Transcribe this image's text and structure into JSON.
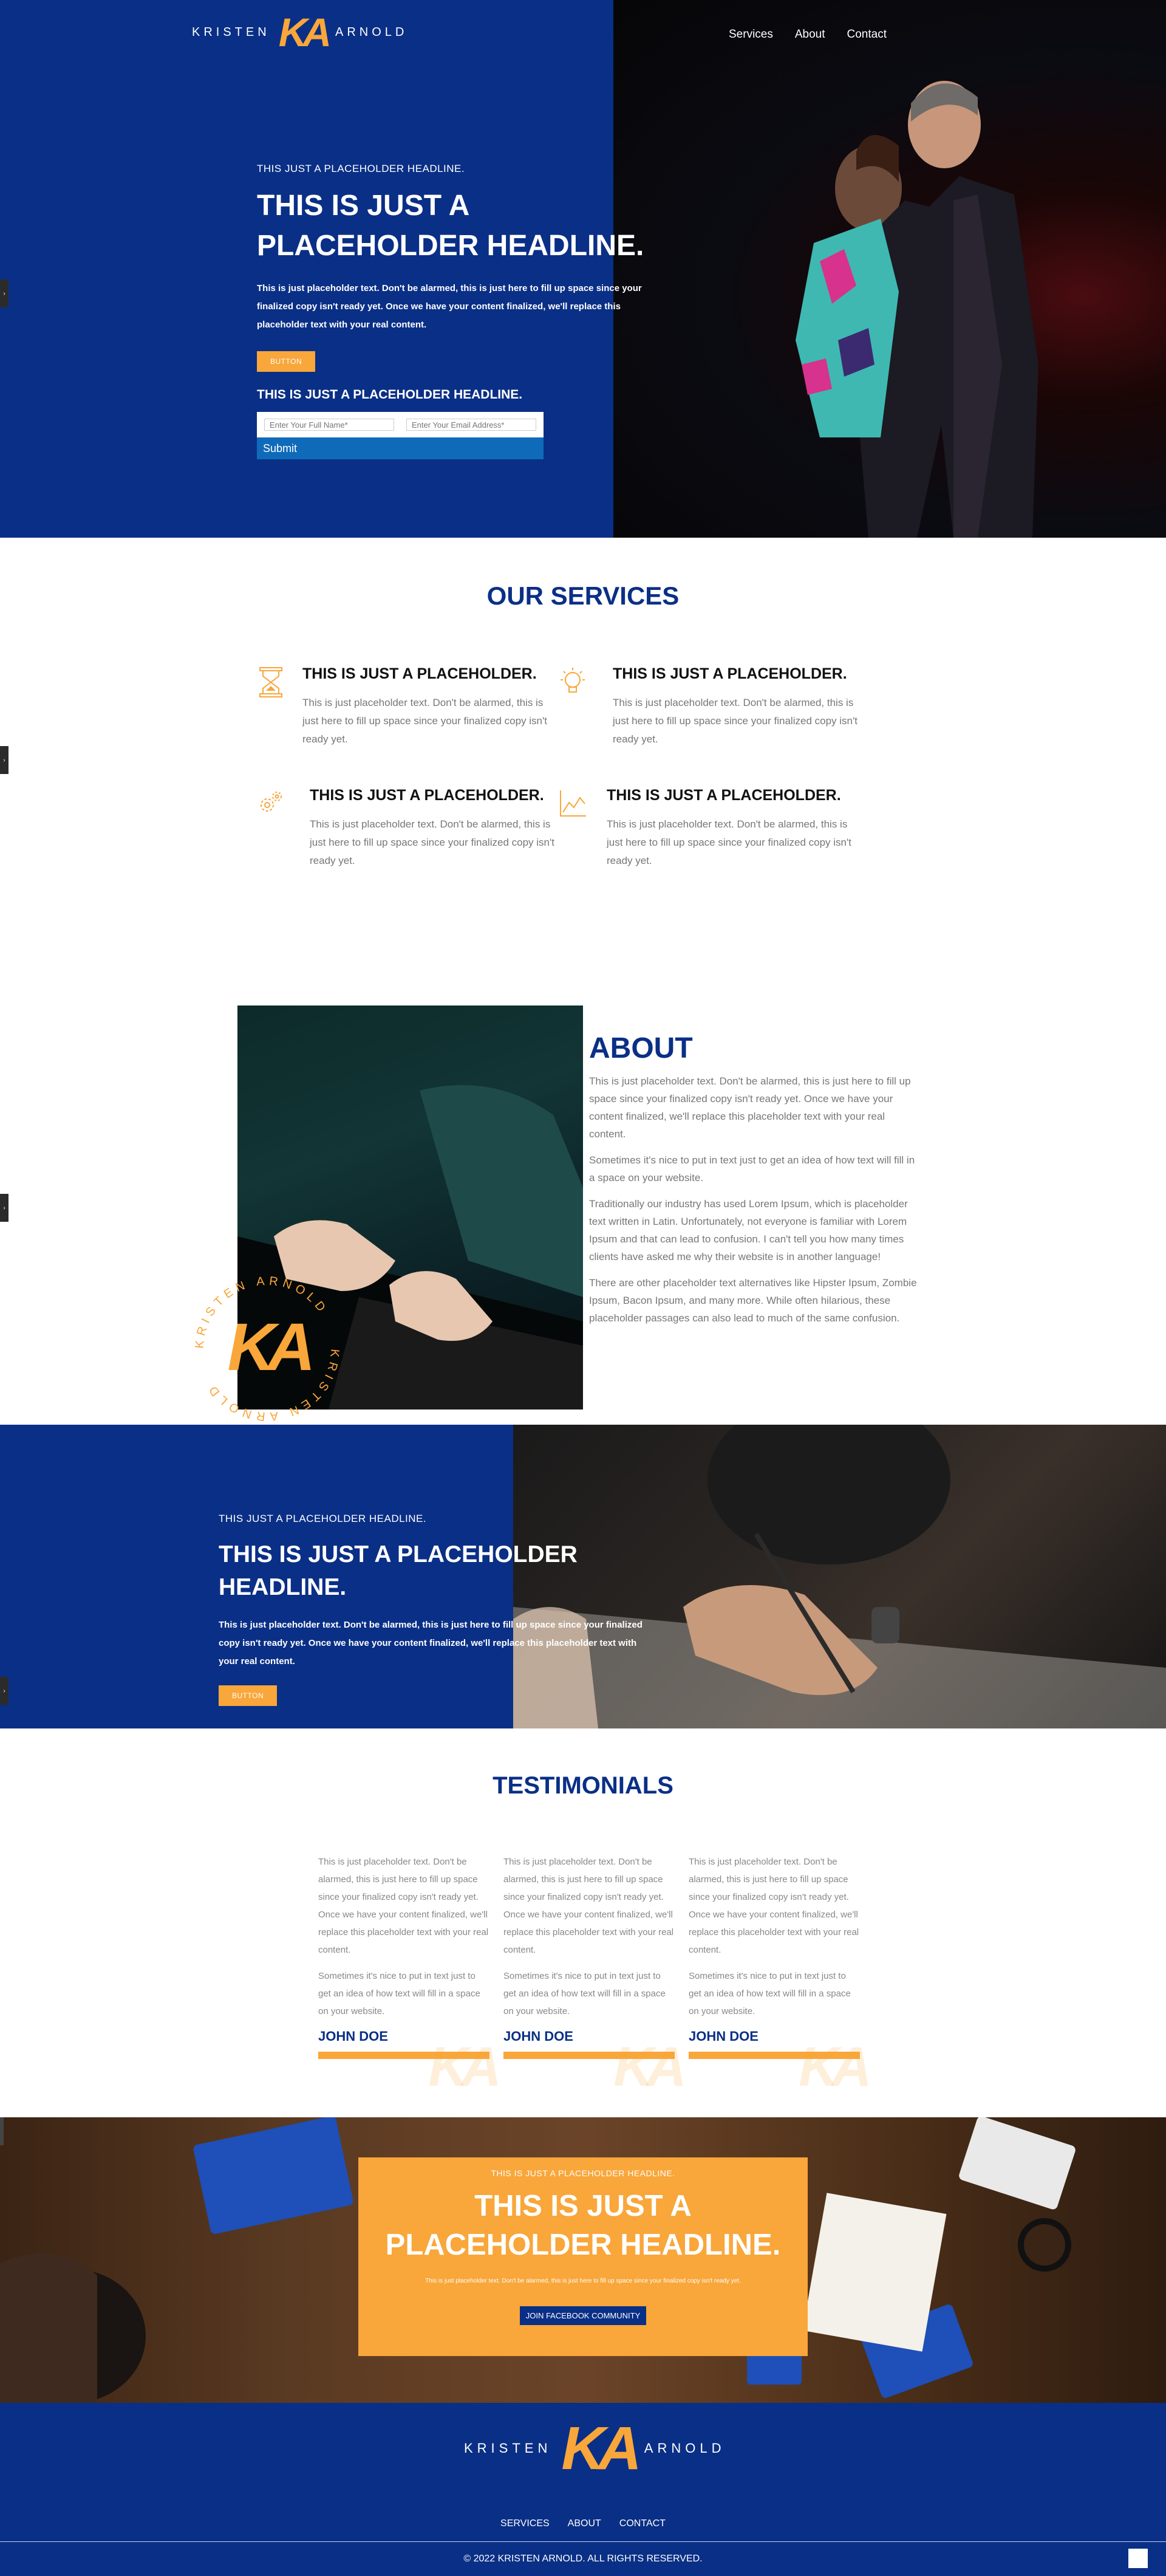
{
  "brand": {
    "first": "KRISTEN",
    "monogram": "KA",
    "last": "ARNOLD",
    "accent": "#f9a63a",
    "navy": "#0a2f86",
    "seal_text": "KRISTEN ARNOLD"
  },
  "nav": [
    "Services",
    "About",
    "Contact"
  ],
  "hero": {
    "eyebrow": "THIS JUST A PLACEHOLDER HEADLINE.",
    "headline": "THIS IS JUST A PLACEHOLDER HEADLINE.",
    "body": "This is just placeholder text. Don't be alarmed, this is just here to fill up space since your finalized copy isn't ready yet. Once we have your content finalized, we'll replace this placeholder text with your real content.",
    "button": "BUTTON",
    "form_heading": "THIS IS JUST A PLACEHOLDER HEADLINE.",
    "name_placeholder": "Enter Your Full Name*",
    "email_placeholder": "Enter Your Email Address*",
    "submit": "Submit"
  },
  "services": {
    "title": "OUR SERVICES",
    "items": [
      {
        "icon": "hourglass-icon",
        "title": "THIS IS JUST A PLACEHOLDER.",
        "body": "This is just placeholder text. Don't be alarmed, this is just here to fill up space since your finalized copy isn't ready yet."
      },
      {
        "icon": "lightbulb-icon",
        "title": "THIS IS JUST A PLACEHOLDER.",
        "body": "This is just placeholder text. Don't be alarmed, this is just here to fill up space since your finalized copy isn't ready yet."
      },
      {
        "icon": "gears-icon",
        "title": "THIS IS JUST A PLACEHOLDER.",
        "body": "This is just placeholder text. Don't be alarmed, this is just here to fill up space since your finalized copy isn't ready yet."
      },
      {
        "icon": "chart-icon",
        "title": "THIS IS JUST A PLACEHOLDER.",
        "body": "This is just placeholder text. Don't be alarmed, this is just here to fill up space since your finalized copy isn't ready yet."
      }
    ]
  },
  "about": {
    "title": "ABOUT",
    "paragraphs": [
      "This is just placeholder text. Don't be alarmed, this is just here to fill up space since your finalized copy isn't ready yet. Once we have your content finalized, we'll replace this placeholder text with your real content.",
      "Sometimes it's nice to put in text just to get an idea of how text will fill in a space on your website.",
      "Traditionally our industry has used Lorem Ipsum, which is placeholder text written in Latin. Unfortunately, not everyone is familiar with Lorem Ipsum and that can lead to confusion. I can't tell you how many times clients have asked me why their website is in another language!",
      "There are other placeholder text alternatives like Hipster Ipsum, Zombie Ipsum, Bacon Ipsum, and many more. While often hilarious, these placeholder passages can also lead to much of the same confusion."
    ]
  },
  "band": {
    "eyebrow": "THIS JUST A PLACEHOLDER HEADLINE.",
    "headline": "THIS IS JUST A PLACEHOLDER HEADLINE.",
    "body": "This is just placeholder text. Don't be alarmed, this is just here to fill up space since your finalized copy isn't ready yet. Once we have your content finalized, we'll replace this placeholder text with your real content.",
    "button": "BUTTON"
  },
  "testimonials": {
    "title": "TESTIMONIALS",
    "items": [
      {
        "p1": "This is just placeholder text. Don't be alarmed, this is just here to fill up space since your finalized copy isn't ready yet. Once we have your content finalized, we'll replace this placeholder text with your real content.",
        "p2": "Sometimes it's nice to put in text just to get an idea of how text will fill in a space on your website.",
        "name": "JOHN DOE"
      },
      {
        "p1": "This is just placeholder text. Don't be alarmed, this is just here to fill up space since your finalized copy isn't ready yet. Once we have your content finalized, we'll replace this placeholder text with your real content.",
        "p2": "Sometimes it's nice to put in text just to get an idea of how text will fill in a space on your website.",
        "name": "JOHN DOE"
      },
      {
        "p1": "This is just placeholder text. Don't be alarmed, this is just here to fill up space since your finalized copy isn't ready yet. Once we have your content finalized, we'll replace this placeholder text with your real content.",
        "p2": "Sometimes it's nice to put in text just to get an idea of how text will fill in a space on your website.",
        "name": "JOHN DOE"
      }
    ]
  },
  "cta": {
    "eyebrow": "THIS IS JUST A PLACEHOLDER HEADLINE.",
    "headline": "THIS IS JUST A PLACEHOLDER HEADLINE.",
    "body": "This is just placeholder text. Don't be alarmed, this is just here to fill up space since your finalized copy isn't ready yet.",
    "button": "JOIN FACEBOOK COMMUNITY"
  },
  "footer": {
    "nav": [
      "SERVICES",
      "ABOUT",
      "CONTACT"
    ],
    "copyright": "© 2022 KRISTEN ARNOLD. ALL RIGHTS RESERVED."
  }
}
